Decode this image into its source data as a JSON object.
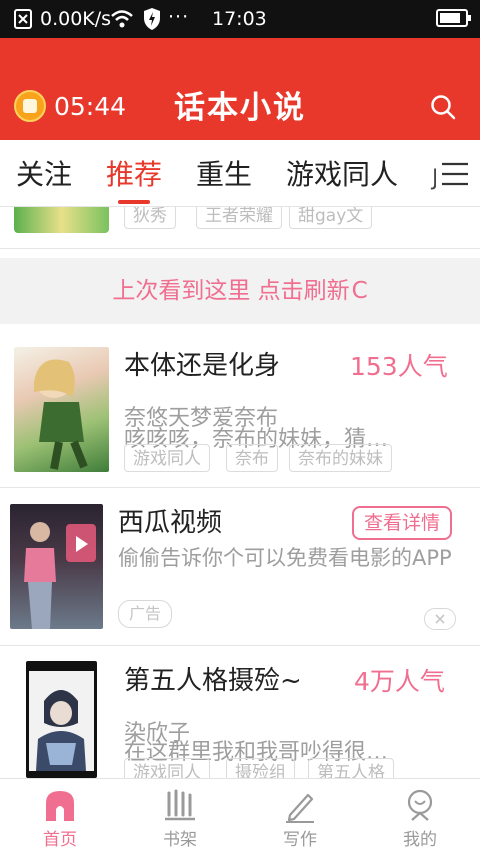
{
  "status_bar": {
    "network_speed": "0.00K/s",
    "more": "···",
    "time": "17:03"
  },
  "header": {
    "timer": "05:44",
    "title": "话本小说"
  },
  "tabs": [
    {
      "label": "关注"
    },
    {
      "label": "推荐"
    },
    {
      "label": "重生"
    },
    {
      "label": "游戏同人"
    },
    {
      "label": "J"
    }
  ],
  "partial_item": {
    "tags": [
      "狄秀",
      "王者荣耀",
      "甜gay文"
    ]
  },
  "refresh": {
    "text": "上次看到这里 点击刷新",
    "icon_glyph": "C"
  },
  "stories": [
    {
      "title": "本体还是化身",
      "popularity": "153人气",
      "author": "奈悠天梦爱奈布",
      "description": "咳咳咳，奈布的妹妹，猜…",
      "tags": [
        "游戏同人",
        "奈布",
        "奈布的妹妹"
      ]
    },
    {
      "title": "第五人格摄殓~",
      "popularity": "4万人气",
      "author": "染欣子",
      "description": "在这群里我和我哥吵得很…",
      "tags": [
        "游戏同人",
        "摄殓组",
        "第五人格"
      ]
    }
  ],
  "ad": {
    "title": "西瓜视频",
    "button": "查看详情",
    "description": "偷偷告诉你个可以免费看电影的APP",
    "badge": "广告"
  },
  "bottom_nav": [
    {
      "label": "首页",
      "active": true
    },
    {
      "label": "书架",
      "active": false
    },
    {
      "label": "写作",
      "active": false
    },
    {
      "label": "我的",
      "active": false
    }
  ],
  "colors": {
    "brand_red": "#e8382b",
    "accent_pink": "#f06e8f"
  }
}
